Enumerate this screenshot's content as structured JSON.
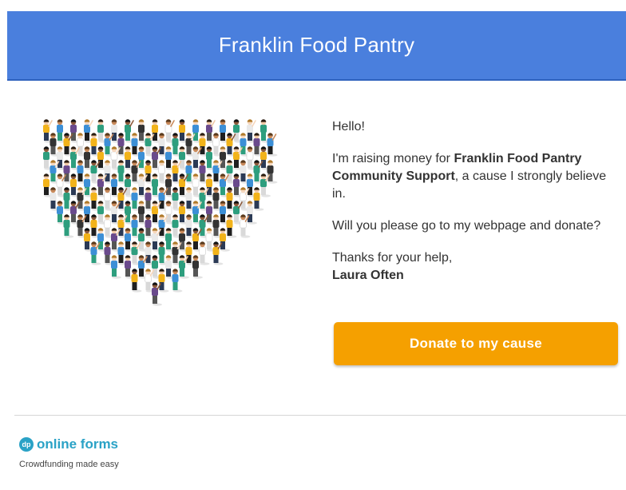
{
  "header": {
    "title": "Franklin Food Pantry",
    "background_color": "#4a7fdd"
  },
  "illustration": {
    "icon": "heart-of-people-illustration"
  },
  "message": {
    "greeting": "Hello!",
    "intro_prefix": "I'm raising money for ",
    "cause_name": "Franklin Food Pantry Community Support",
    "intro_suffix": ", a cause I strongly believe in.",
    "request": "Will you please go to my webpage and donate?",
    "thanks": "Thanks for your help,",
    "sender": "Laura Often"
  },
  "donate_button": {
    "label": "Donate to my cause",
    "color": "#f5a000"
  },
  "footer": {
    "logo_text": "dp",
    "brand_name": "online forms",
    "tagline": "Crowdfunding made easy",
    "brand_color": "#2aa2c6"
  }
}
